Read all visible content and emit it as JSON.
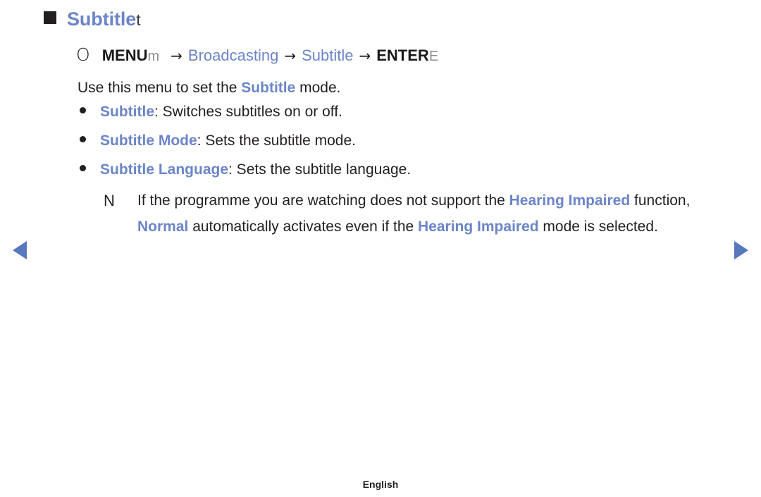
{
  "heading": {
    "title": "Subtitle",
    "key_glyph": "t",
    "bullet_icon": "filled-square"
  },
  "menu_path": {
    "lead_glyph": "O",
    "menu_label": "MENU",
    "menu_key_glyph": "m",
    "arrow": "→",
    "step_broadcasting": "Broadcasting",
    "step_subtitle": "Subtitle",
    "enter_label": "ENTER",
    "enter_key_glyph": "E",
    "full_text": "O MENUm → Broadcasting → Subtitle → ENTERE"
  },
  "intro": {
    "before": "Use this menu to set the ",
    "highlight": "Subtitle",
    "after": " mode."
  },
  "bullets": [
    {
      "term": "Subtitle",
      "description": ": Switches subtitles on or off."
    },
    {
      "term": "Subtitle Mode",
      "description": ": Sets the subtitle mode."
    },
    {
      "term": "Subtitle Language",
      "description": ": Sets the subtitle language."
    }
  ],
  "note": {
    "marker": "N",
    "seg1": "If the programme you are watching does not support the ",
    "seg2_blue": "Hearing Impaired",
    "seg3": " function, ",
    "seg4_blue": "Normal",
    "seg5": " automatically activates even if the ",
    "seg6_blue": "Hearing Impaired",
    "seg7": " mode is selected.",
    "full_text": "If the programme you are watching does not support the Hearing Impaired function, Normal automatically activates even if the Hearing Impaired mode is selected."
  },
  "nav": {
    "prev_label": "◀",
    "next_label": "▶"
  },
  "footer": {
    "language": "English"
  },
  "colors": {
    "accent_blue": "#6b85c8",
    "arrow_blue": "#5878bd",
    "text": "#231f20",
    "muted_key": "#8d8d8d"
  }
}
